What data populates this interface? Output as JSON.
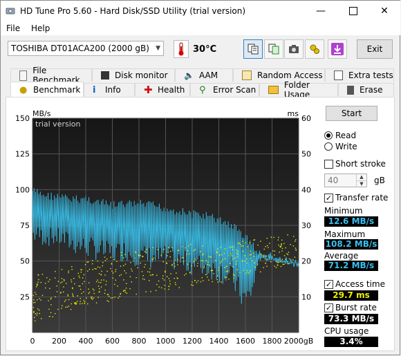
{
  "window": {
    "title": "HD Tune Pro 5.60 - Hard Disk/SSD Utility (trial version)"
  },
  "menu": {
    "items": [
      "File",
      "Help"
    ]
  },
  "toolbar": {
    "drive": "TOSHIBA DT01ACA200 (2000 gB)",
    "temperature": "30°C",
    "exit_label": "Exit"
  },
  "tabs_top": [
    "File Benchmark",
    "Disk monitor",
    "AAM",
    "Random Access",
    "Extra tests"
  ],
  "tabs_bottom": [
    "Benchmark",
    "Info",
    "Health",
    "Error Scan",
    "Folder Usage",
    "Erase"
  ],
  "active_tab": "Benchmark",
  "controls": {
    "start_label": "Start",
    "read_label": "Read",
    "write_label": "Write",
    "mode": "Read",
    "short_stroke_label": "Short stroke",
    "short_stroke_checked": false,
    "short_stroke_value": "40",
    "short_stroke_unit": "gB",
    "transfer_rate_label": "Transfer rate",
    "transfer_rate_checked": true,
    "access_time_label": "Access time",
    "access_time_checked": true,
    "burst_rate_label": "Burst rate",
    "burst_rate_checked": true
  },
  "results": {
    "minimum_label": "Minimum",
    "minimum": "12.6 MB/s",
    "maximum_label": "Maximum",
    "maximum": "108.2 MB/s",
    "average_label": "Average",
    "average": "71.2 MB/s",
    "access_time": "29.7 ms",
    "burst_rate": "73.3 MB/s",
    "cpu_label": "CPU usage",
    "cpu": "3.4%"
  },
  "colors": {
    "transfer": "#38b8e0",
    "access": "#f0f000",
    "chart_bg": "#232323",
    "grid": "#555555"
  },
  "chart_data": {
    "type": "line",
    "watermark": "trial version",
    "ylabel_left": "MB/s",
    "ylabel_right": "ms",
    "xlabel_unit": "gB",
    "x_ticks": [
      "0",
      "200",
      "400",
      "600",
      "800",
      "1000",
      "1200",
      "1400",
      "1600",
      "1800",
      "2000gB"
    ],
    "y_left_ticks": [
      "150",
      "125",
      "100",
      "75",
      "50",
      "25"
    ],
    "y_right_ticks": [
      "60",
      "50",
      "40",
      "30",
      "20",
      "10"
    ],
    "xlim": [
      0,
      2000
    ],
    "ylim_left": [
      0,
      150
    ],
    "ylim_right": [
      0,
      60
    ],
    "grid": true,
    "series": [
      {
        "name": "Transfer rate",
        "x": [
          0,
          100,
          200,
          300,
          400,
          500,
          600,
          700,
          800,
          900,
          1000,
          1100,
          1200,
          1300,
          1400,
          1500,
          1550,
          1600,
          1650,
          1700,
          1800,
          1900,
          2000
        ],
        "values_high": [
          102,
          99,
          98,
          96,
          97,
          94,
          92,
          93,
          93,
          92,
          90,
          88,
          86,
          85,
          82,
          78,
          74,
          70,
          65,
          58,
          56,
          53,
          51
        ],
        "values_low": [
          62,
          60,
          60,
          55,
          52,
          50,
          48,
          50,
          45,
          44,
          45,
          42,
          40,
          38,
          35,
          30,
          20,
          12.6,
          22,
          50,
          50,
          48,
          48
        ]
      },
      {
        "name": "Access time",
        "x": [
          0,
          200,
          400,
          600,
          800,
          1000,
          1200,
          1400,
          1600,
          1800,
          2000
        ],
        "values_min": [
          3,
          5,
          8,
          9,
          11,
          12,
          13,
          14,
          16,
          18,
          19
        ],
        "values_max": [
          16,
          18,
          20,
          22,
          24,
          24,
          25,
          24,
          26,
          27,
          28
        ]
      }
    ]
  }
}
